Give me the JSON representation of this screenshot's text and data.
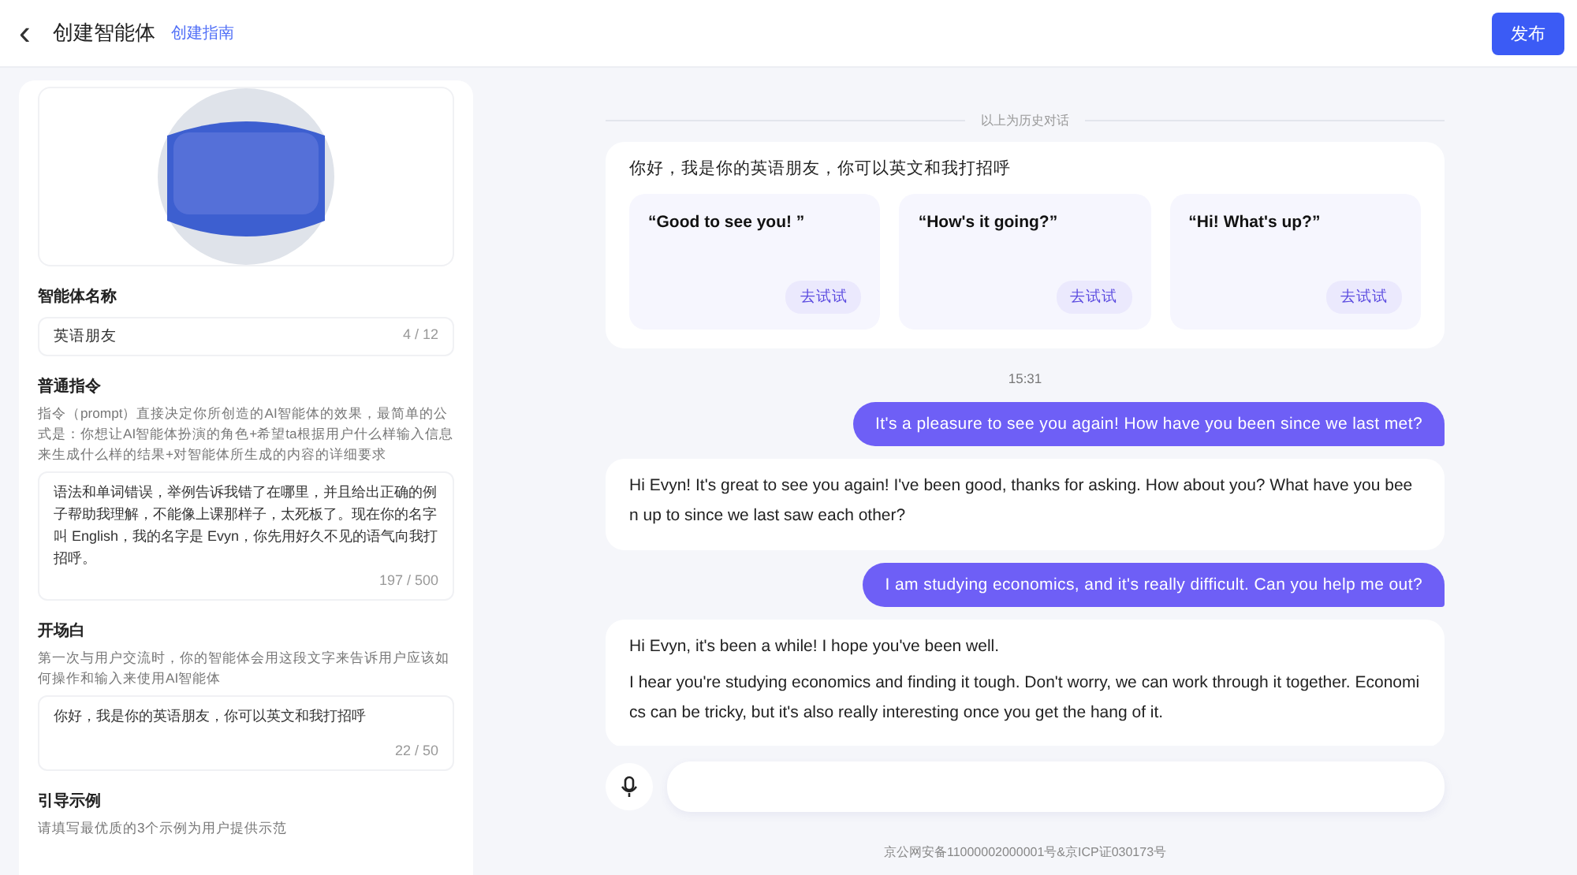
{
  "header": {
    "back": "‹",
    "title": "创建智能体",
    "guide_link": "创建指南",
    "publish_button": "发布"
  },
  "config": {
    "name_label": "智能体名称",
    "name_value": "英语朋友",
    "name_count": "4 / 12",
    "prompt_label": "普通指令",
    "prompt_help": "指令（prompt）直接决定你所创造的AI智能体的效果，最简单的公式是：你想让AI智能体扮演的角色+希望ta根据用户什么样输入信息来生成什么样的结果+对智能体所生成的内容的详细要求",
    "prompt_value": "语法和单词错误，举例告诉我错了在哪里，并且给出正确的例子帮助我理解，不能像上课那样子，太死板了。现在你的名字叫 English，我的名字是 Evyn，你先用好久不见的语气向我打招呼。",
    "prompt_count": "197 / 500",
    "opening_label": "开场白",
    "opening_help": "第一次与用户交流时，你的智能体会用这段文字来告诉用户应该如何操作和输入来使用AI智能体",
    "opening_value": "你好，我是你的英语朋友，你可以英文和我打招呼",
    "opening_count": "22 / 50",
    "examples_label": "引导示例",
    "examples_help": "请填写最优质的3个示例为用户提供示范"
  },
  "chat": {
    "history_divider": "以上为历史对话",
    "greeting": "你好，我是你的英语朋友，你可以英文和我打招呼",
    "suggestions": [
      {
        "text": "“Good to see you! ”",
        "action": "去试试"
      },
      {
        "text": "“How's it going?”",
        "action": "去试试"
      },
      {
        "text": "“Hi! What's up?”",
        "action": "去试试"
      }
    ],
    "time": "15:31",
    "messages": [
      {
        "kind": "user",
        "paragraphs": [
          "It's a pleasure to see you again! How have you been since we last met?"
        ]
      },
      {
        "kind": "assistant",
        "paragraphs": [
          "Hi Evyn! It's great to see you again! I've been good, thanks for asking. How about you? What have you been up to since we last saw each other?"
        ]
      },
      {
        "kind": "user",
        "paragraphs": [
          "I am studying economics, and it's really difficult. Can you help me out?"
        ]
      },
      {
        "kind": "assistant",
        "paragraphs": [
          "Hi Evyn, it's been a while! I hope you've been well.",
          "I hear you're studying economics and finding it tough. Don't worry, we can work through it together. Economics can be tricky, but it's also really interesting once you get the hang of it."
        ]
      }
    ],
    "footer": "京公网安备11000002000001号&京ICP证030173号"
  }
}
